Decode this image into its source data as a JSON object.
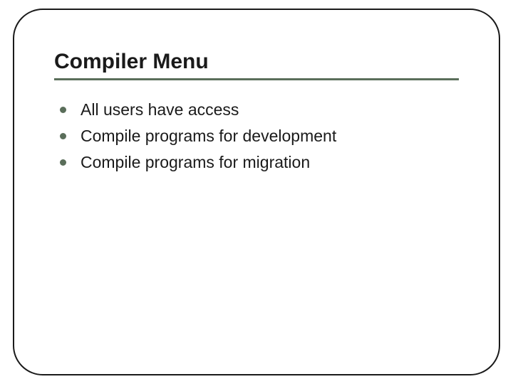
{
  "title": "Compiler Menu",
  "bullets": [
    "All users have access",
    "Compile programs for development",
    "Compile programs for migration"
  ]
}
